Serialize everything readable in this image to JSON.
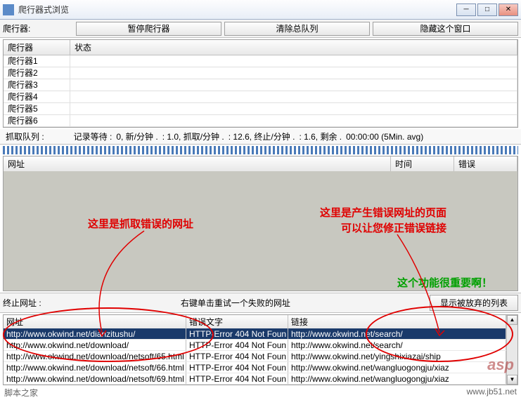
{
  "window": {
    "title": "爬行器式浏览"
  },
  "toolbar": {
    "label": "爬行器:",
    "btn_pause": "暂停爬行器",
    "btn_clear": "清除总队列",
    "btn_hide": "隐藏这个窗口"
  },
  "crawler_grid": {
    "headers": {
      "name": "爬行器",
      "status": "状态"
    },
    "rows": [
      "爬行器1",
      "爬行器2",
      "爬行器3",
      "爬行器4",
      "爬行器5",
      "爬行器6"
    ]
  },
  "status": {
    "label": "抓取队列 :",
    "wait": "记录等待 :",
    "wait_val": "0, 新/分钟 .",
    "rate1": ": 1.0, 抓取/分钟 .",
    "rate2": ": 12.6, 终止/分钟 .",
    "rate3": ": 1.6, 剩余 .",
    "time": "00:00:00 (5Min. avg)"
  },
  "mid_grid": {
    "h1": "网址",
    "h2": "时间",
    "h3": "错误"
  },
  "annotations": {
    "a1": "这里是抓取错误的网址",
    "a2a": "这里是产生错误网址的页面",
    "a2b": "可以让您修正错误链接",
    "a3": "这个功能很重要啊！"
  },
  "end_row": {
    "label": "终止网址 :",
    "hint": "右键单击重试一个失败的网址",
    "btn": "显示被放弃的列表"
  },
  "err_grid": {
    "h1": "网址",
    "h2": "错误文字",
    "h3": "链接",
    "rows": [
      {
        "url": "http://www.okwind.net/dianzitushu/",
        "err": "HTTP-Error 404 Not Foun",
        "link": "http://www.okwind.net/search/",
        "sel": true
      },
      {
        "url": "http://www.okwind.net/download/",
        "err": "HTTP-Error 404 Not Foun",
        "link": "http://www.okwind.net/search/",
        "sel": false
      },
      {
        "url": "http://www.okwind.net/download/netsoft/65.html",
        "err": "HTTP-Error 404 Not Foun",
        "link": "http://www.okwind.net/yingshixiazai/ship",
        "sel": false
      },
      {
        "url": "http://www.okwind.net/download/netsoft/66.html",
        "err": "HTTP-Error 404 Not Foun",
        "link": "http://www.okwind.net/wangluogongju/xiaz",
        "sel": false
      },
      {
        "url": "http://www.okwind.net/download/netsoft/69.html",
        "err": "HTTP-Error 404 Not Foun",
        "link": "http://www.okwind.net/wangluogongju/xiaz",
        "sel": false
      }
    ]
  },
  "footer": {
    "left": "脚本之家",
    "right": "www.jb51.net"
  },
  "watermark": "asp"
}
